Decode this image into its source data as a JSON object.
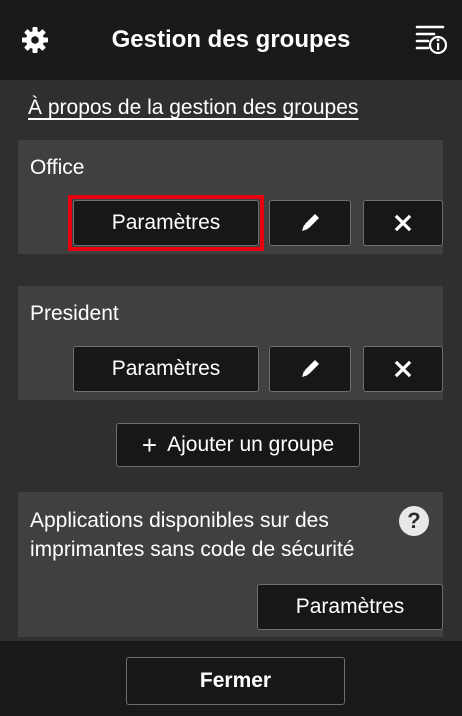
{
  "header": {
    "title": "Gestion des groupes",
    "left_icon": "gear-icon",
    "right_icon": "menu-info-icon"
  },
  "about_link": "À propos de la gestion des groupes",
  "groups": [
    {
      "name": "Office",
      "settings_label": "Paramètres",
      "edit_icon": "pencil-icon",
      "delete_icon": "close-icon",
      "highlighted": true
    },
    {
      "name": "President",
      "settings_label": "Paramètres",
      "edit_icon": "pencil-icon",
      "delete_icon": "close-icon",
      "highlighted": false
    }
  ],
  "add_group": {
    "icon": "+",
    "label": "Ajouter un groupe"
  },
  "apps_panel": {
    "text": "Applications disponibles sur des imprimantes sans code de sécurité",
    "help_icon": "?",
    "settings_label": "Paramètres"
  },
  "footer": {
    "close_label": "Fermer"
  },
  "colors": {
    "background": "#2f2f2f",
    "bars": "#191919",
    "card": "#404040",
    "button": "#171717",
    "highlight": "#e60012"
  }
}
